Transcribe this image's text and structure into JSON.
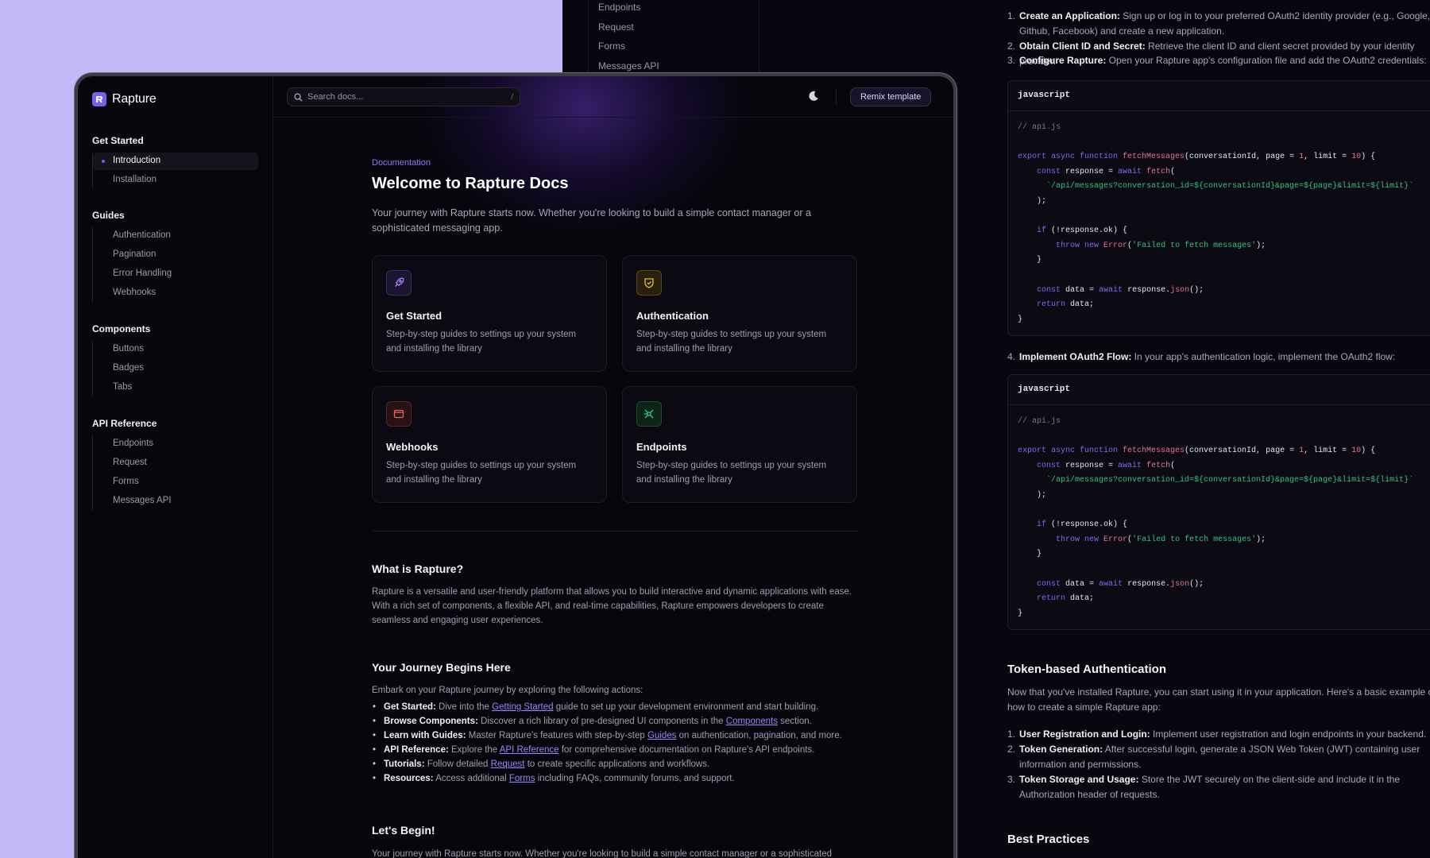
{
  "back": {
    "sidebar_items": [
      "Endpoints",
      "Request",
      "Forms",
      "Messages API"
    ],
    "steps1": [
      {
        "num": "1.",
        "bold": "Create an Application:",
        "text": " Sign up or log in to your preferred OAuth2 identity provider (e.g., Google, Github, Facebook) and create a new application."
      },
      {
        "num": "2.",
        "bold": "Obtain Client ID and Secret:",
        "text": " Retrieve the client ID and client secret provided by your identity provider."
      },
      {
        "num": "3.",
        "bold": "Configure Rapture:",
        "text": " Open your Rapture app's configuration file and add the OAuth2 credentials:"
      }
    ],
    "code_lang": "javascript",
    "code_comment": "// api.js",
    "step4": {
      "num": "4.",
      "bold": "Implement OAuth2 Flow:",
      "text": " In your app's authentication logic, implement the OAuth2 flow:"
    },
    "token_heading": "Token-based Authentication",
    "token_text": "Now that you've installed Rapture, you can start using it in your application. Here's a basic example of how to create a simple Rapture app:",
    "steps2": [
      {
        "num": "1.",
        "bold": "User Registration and Login:",
        "text": " Implement user registration and login endpoints in your backend."
      },
      {
        "num": "2.",
        "bold": "Token Generation:",
        "text": " After successful login, generate a JSON Web Token (JWT) containing user information and permissions."
      },
      {
        "num": "3.",
        "bold": "Token Storage and Usage:",
        "text": " Store the JWT securely on the client-side and include it in the Authorization header of requests."
      }
    ],
    "best_practices": "Best Practices"
  },
  "app": {
    "logo": "Rapture",
    "search_placeholder": "Search docs...",
    "search_key": "/",
    "remix": "Remix template"
  },
  "nav": [
    {
      "title": "Get Started",
      "items": [
        "Introduction",
        "Installation"
      ]
    },
    {
      "title": "Guides",
      "items": [
        "Authentication",
        "Pagination",
        "Error Handling",
        "Webhooks"
      ]
    },
    {
      "title": "Components",
      "items": [
        "Buttons",
        "Badges",
        "Tabs"
      ]
    },
    {
      "title": "API Reference",
      "items": [
        "Endpoints",
        "Request",
        "Forms",
        "Messages API"
      ]
    }
  ],
  "page": {
    "eyebrow": "Documentation",
    "title": "Welcome to Rapture Docs",
    "lead": "Your journey with Rapture starts now. Whether you're looking to build a simple contact manager or a sophisticated messaging app.",
    "cards": [
      {
        "title": "Get Started",
        "desc": "Step-by-step guides to settings up your system and installing the library",
        "icon": "rocket-icon",
        "color": "#8b6cf7"
      },
      {
        "title": "Authentication",
        "desc": "Step-by-step guides to settings up your system and installing the library",
        "icon": "shield-icon",
        "color": "#e5b43c"
      },
      {
        "title": "Webhooks",
        "desc": "Step-by-step guides to settings up your system and installing the library",
        "icon": "window-icon",
        "color": "#e0605e"
      },
      {
        "title": "Endpoints",
        "desc": "Step-by-step guides to settings up your system and installing the library",
        "icon": "network-icon",
        "color": "#38c07a"
      }
    ],
    "what_heading": "What is Rapture?",
    "what_text": "Rapture is a versatile and user-friendly platform that allows you to build interactive and dynamic applications with ease. With a rich set of components, a flexible API, and real-time capabilities, Rapture empowers developers to create seamless and engaging user experiences.",
    "journey_heading": "Your Journey Begins Here",
    "journey_intro": "Embark on your Rapture journey by exploring the following actions:",
    "journey_items": [
      {
        "bold": "Get Started:",
        "pre": " Dive into the ",
        "link": "Getting Started",
        "post": " guide to set up your development environment and start building."
      },
      {
        "bold": "Browse Components:",
        "pre": " Discover a rich library of pre-designed UI components in the ",
        "link": "Components",
        "post": " section."
      },
      {
        "bold": "Learn with Guides:",
        "pre": " Master Rapture's features with step-by-step ",
        "link": "Guides",
        "post": " on authentication, pagination, and more."
      },
      {
        "bold": "API Reference:",
        "pre": " Explore the ",
        "link": "API Reference",
        "post": " for comprehensive documentation on Rapture's API endpoints."
      },
      {
        "bold": "Tutorials:",
        "pre": " Follow detailed ",
        "link": "Request",
        "post": " to create specific applications and workflows."
      },
      {
        "bold": "Resources:",
        "pre": " Access additional ",
        "link": "Forms",
        "post": " including FAQs, community forums, and support."
      }
    ],
    "begin_heading": "Let's Begin!",
    "begin_text": "Your journey with Rapture starts now. Whether you're looking to build a simple contact manager or a sophisticated"
  }
}
